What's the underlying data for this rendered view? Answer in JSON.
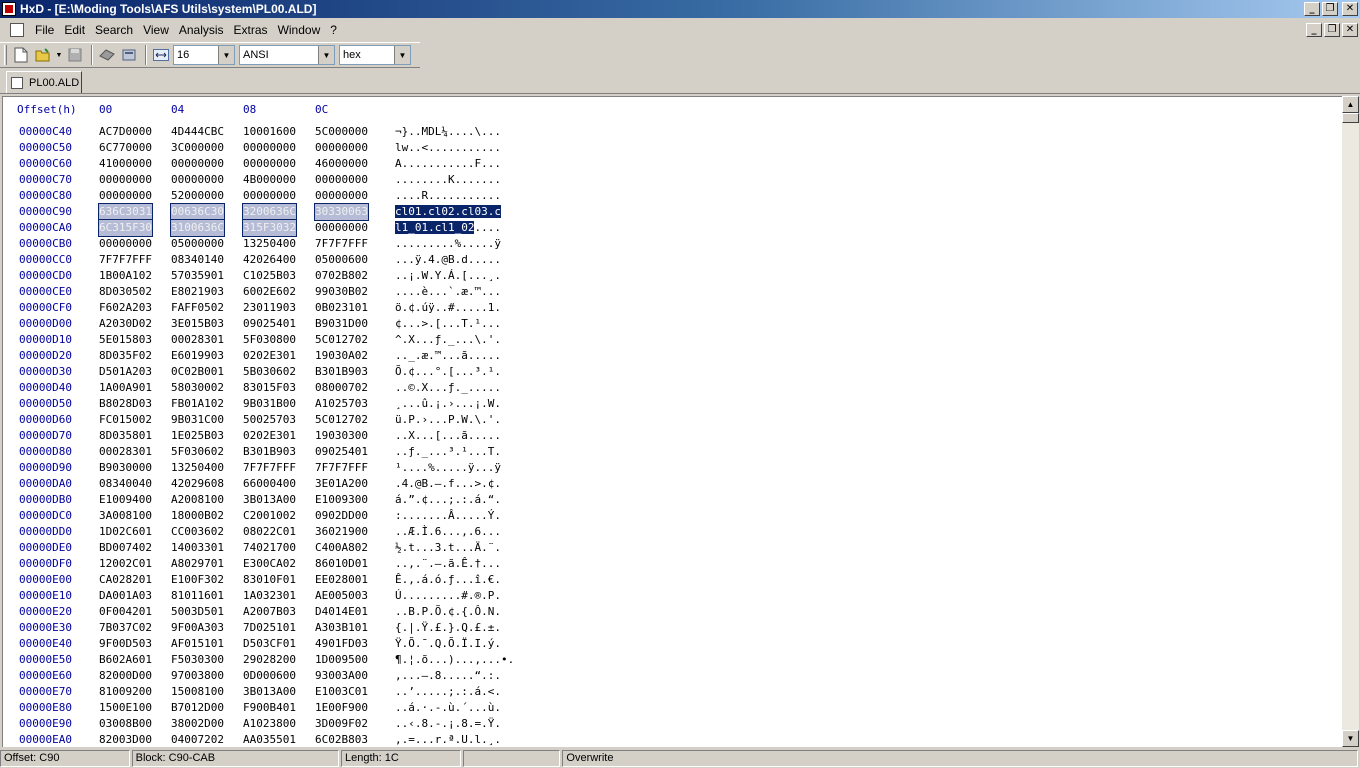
{
  "window": {
    "title": "HxD - [E:\\Moding Tools\\AFS Utils\\system\\PL00.ALD]",
    "minimize": "_",
    "restore": "❐",
    "close": "✕"
  },
  "menu": {
    "items": [
      "File",
      "Edit",
      "Search",
      "View",
      "Analysis",
      "Extras",
      "Window",
      "?"
    ]
  },
  "toolbar": {
    "bytes_per_row": "16",
    "charset": "ANSI",
    "display_mode": "hex"
  },
  "tab": {
    "label": "PL00.ALD"
  },
  "hex": {
    "header": {
      "offset": "Offset(h)",
      "cols": [
        "00",
        "04",
        "08",
        "0C"
      ]
    },
    "rows": [
      {
        "o": "00000C40",
        "h": [
          "AC7D0000",
          "4D444CBC",
          "10001600",
          "5C000000"
        ],
        "a": "¬}..MDL¼....\\..."
      },
      {
        "o": "00000C50",
        "h": [
          "6C770000",
          "3C000000",
          "00000000",
          "00000000"
        ],
        "a": "lw..<..........."
      },
      {
        "o": "00000C60",
        "h": [
          "41000000",
          "00000000",
          "00000000",
          "46000000"
        ],
        "a": "A...........F..."
      },
      {
        "o": "00000C70",
        "h": [
          "00000000",
          "00000000",
          "4B000000",
          "00000000"
        ],
        "a": "........K......."
      },
      {
        "o": "00000C80",
        "h": [
          "00000000",
          "52000000",
          "00000000",
          "00000000"
        ],
        "a": "....R..........."
      },
      {
        "o": "00000C90",
        "h": [
          "636C3031",
          "00636C30",
          "3200636C",
          "30330063"
        ],
        "a": "cl01.cl02.cl03.c",
        "sel": [
          0,
          1,
          2,
          3
        ],
        "asel": 16
      },
      {
        "o": "00000CA0",
        "h": [
          "6C315F30",
          "3100636C",
          "315F3032",
          "00000000"
        ],
        "a": "l1_01.cl1_02....",
        "sel": [
          0,
          1,
          2
        ],
        "asel": 12
      },
      {
        "o": "00000CB0",
        "h": [
          "00000000",
          "05000000",
          "13250400",
          "7F7F7FFF"
        ],
        "a": ".........%.....ÿ"
      },
      {
        "o": "00000CC0",
        "h": [
          "7F7F7FFF",
          "08340140",
          "42026400",
          "05000600"
        ],
        "a": "...ÿ.4.@B.d....."
      },
      {
        "o": "00000CD0",
        "h": [
          "1B00A102",
          "57035901",
          "C1025B03",
          "0702B802"
        ],
        "a": "..¡.W.Y.Á.[...¸."
      },
      {
        "o": "00000CE0",
        "h": [
          "8D030502",
          "E8021903",
          "6002E602",
          "99030B02"
        ],
        "a": "....è...`.æ.™..."
      },
      {
        "o": "00000CF0",
        "h": [
          "F602A203",
          "FAFF0502",
          "23011903",
          "0B023101"
        ],
        "a": "ö.¢.úÿ..#.....1."
      },
      {
        "o": "00000D00",
        "h": [
          "A2030D02",
          "3E015B03",
          "09025401",
          "B9031D00"
        ],
        "a": "¢...>.[...T.¹..."
      },
      {
        "o": "00000D10",
        "h": [
          "5E015803",
          "00028301",
          "5F030800",
          "5C012702"
        ],
        "a": "^.X...ƒ._...\\.'."
      },
      {
        "o": "00000D20",
        "h": [
          "8D035F02",
          "E6019903",
          "0202E301",
          "19030A02"
        ],
        "a": ".._.æ.™...ã....."
      },
      {
        "o": "00000D30",
        "h": [
          "D501A203",
          "0C02B001",
          "5B030602",
          "B301B903"
        ],
        "a": "Õ.¢...°.[...³.¹."
      },
      {
        "o": "00000D40",
        "h": [
          "1A00A901",
          "58030002",
          "83015F03",
          "08000702"
        ],
        "a": "..©.X...ƒ._....."
      },
      {
        "o": "00000D50",
        "h": [
          "B8028D03",
          "FB01A102",
          "9B031B00",
          "A1025703"
        ],
        "a": "¸...û.¡.›...¡.W."
      },
      {
        "o": "00000D60",
        "h": [
          "FC015002",
          "9B031C00",
          "50025703",
          "5C012702"
        ],
        "a": "ü.P.›...P.W.\\.'."
      },
      {
        "o": "00000D70",
        "h": [
          "8D035801",
          "1E025B03",
          "0202E301",
          "19030300"
        ],
        "a": "..X...[...ã....."
      },
      {
        "o": "00000D80",
        "h": [
          "00028301",
          "5F030602",
          "B301B903",
          "09025401"
        ],
        "a": "..ƒ._...³.¹...T."
      },
      {
        "o": "00000D90",
        "h": [
          "B9030000",
          "13250400",
          "7F7F7FFF",
          "7F7F7FFF"
        ],
        "a": "¹....%.....ÿ...ÿ"
      },
      {
        "o": "00000DA0",
        "h": [
          "08340040",
          "42029608",
          "66000400",
          "3E01A200"
        ],
        "a": ".4.@B.–.f...>.¢."
      },
      {
        "o": "00000DB0",
        "h": [
          "E1009400",
          "A2008100",
          "3B013A00",
          "E1009300"
        ],
        "a": "á.”.¢...;.:.á.“."
      },
      {
        "o": "00000DC0",
        "h": [
          "3A008100",
          "18000B02",
          "C2001002",
          "0902DD00"
        ],
        "a": ":.......Â.....Ý."
      },
      {
        "o": "00000DD0",
        "h": [
          "1D02C601",
          "CC003602",
          "08022C01",
          "36021900"
        ],
        "a": "..Æ.Ì.6...,.6..."
      },
      {
        "o": "00000DE0",
        "h": [
          "BD007402",
          "14003301",
          "74021700",
          "C400A802"
        ],
        "a": "½.t...3.t...Ä.¨."
      },
      {
        "o": "00000DF0",
        "h": [
          "12002C01",
          "A8029701",
          "E300CA02",
          "86010D01"
        ],
        "a": "..,.¨.—.ã.Ê.†..."
      },
      {
        "o": "00000E00",
        "h": [
          "CA028201",
          "E100F302",
          "83010F01",
          "EE028001"
        ],
        "a": "Ê.‚.á.ó.ƒ...î.€."
      },
      {
        "o": "00000E10",
        "h": [
          "DA001A03",
          "81011601",
          "1A032301",
          "AE005003"
        ],
        "a": "Ú.........#.®.P."
      },
      {
        "o": "00000E20",
        "h": [
          "0F004201",
          "5003D501",
          "A2007B03",
          "D4014E01"
        ],
        "a": "..B.P.Õ.¢.{.Ô.N."
      },
      {
        "o": "00000E30",
        "h": [
          "7B037C02",
          "9F00A303",
          "7D025101",
          "A303B101"
        ],
        "a": "{.|.Ÿ.£.}.Q.£.±."
      },
      {
        "o": "00000E40",
        "h": [
          "9F00D503",
          "AF015101",
          "D503CF01",
          "4901FD03"
        ],
        "a": "Ÿ.Õ.¯.Q.Õ.Ï.I.ý."
      },
      {
        "o": "00000E50",
        "h": [
          "B602A601",
          "F5030300",
          "29028200",
          "1D009500"
        ],
        "a": "¶.¦.õ...)...‚...•."
      },
      {
        "o": "00000E60",
        "h": [
          "82000D00",
          "97003800",
          "0D000600",
          "93003A00"
        ],
        "a": "‚...—.8.....“.:."
      },
      {
        "o": "00000E70",
        "h": [
          "81009200",
          "15008100",
          "3B013A00",
          "E1003C01"
        ],
        "a": "..’.....;.:.á.<."
      },
      {
        "o": "00000E80",
        "h": [
          "1500E100",
          "B7012D00",
          "F900B401",
          "1E00F900"
        ],
        "a": "..á.·.-.ù.´...ù."
      },
      {
        "o": "00000E90",
        "h": [
          "03008B00",
          "38002D00",
          "A1023800",
          "3D009F02"
        ],
        "a": "..‹.8.-.¡.8.=.Ÿ."
      },
      {
        "o": "00000EA0",
        "h": [
          "82003D00",
          "04007202",
          "AA035501",
          "6C02B803"
        ],
        "a": "‚.=...r.ª.U.l.¸."
      }
    ]
  },
  "status": {
    "offset": "Offset: C90",
    "block": "Block: C90-CAB",
    "length": "Length: 1C",
    "empty": "",
    "mode": "Overwrite"
  },
  "colors": {
    "offset_text": "#0000a0",
    "selection_ascii_bg": "#0a246a",
    "selection_hex_bg": "#b6bcd6"
  }
}
